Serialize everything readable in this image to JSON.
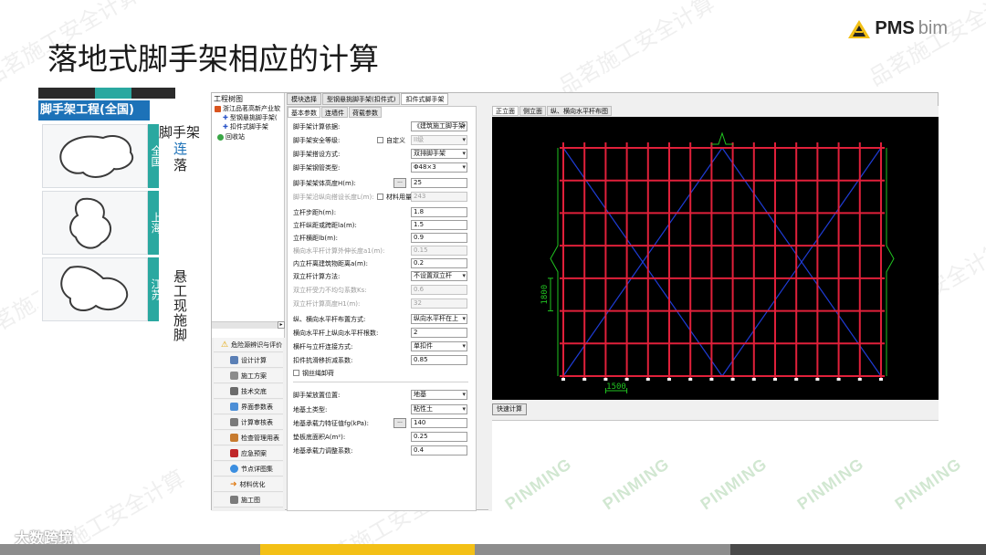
{
  "slide": {
    "title": "落地式脚手架相应的计算",
    "logo_main": "PMS",
    "logo_sub": "bim",
    "watermarks": [
      "品茗施工安全计算",
      "品茗施工安全计算",
      "品茗施工安全计算",
      "品茗施工安全计算",
      "品茗施工安全计算",
      "品茗施工安全计算",
      "品茗施工安全计算",
      "品茗施工安全计算"
    ],
    "green_watermark": "PINMING",
    "footer_brand": "大数跨境",
    "colors": {
      "accent_yellow": "#f3c016",
      "strip_gray": "#8d8d8d",
      "strip_dark": "#4a4a4a",
      "scaffold_red": "#e0203a",
      "brace_blue": "#1f3cd6",
      "dim_green": "#21c421"
    }
  },
  "bg_app": {
    "header": "脚手架工程(全国)",
    "regions": [
      "全国",
      "上海",
      "江苏"
    ],
    "tree_lines": [
      "脚手架",
      "连",
      "落",
      "悬",
      "工",
      "现",
      "施",
      "脚"
    ]
  },
  "tree": {
    "title": "工程树图",
    "items": [
      "浙江品茗高新产业软",
      "型钢悬挑脚手架(",
      "扣件式脚手架",
      "回收站"
    ]
  },
  "nav": {
    "items": [
      "危险源辨识与评价",
      "设计计算",
      "施工方案",
      "技术交底",
      "界面参数表",
      "计算审核表",
      "检查管理用表",
      "应急预案",
      "节点详图集",
      "材料优化",
      "施工图"
    ]
  },
  "top_tabs": [
    "模块选择",
    "型钢悬挑脚手架(扣件式)",
    "扣件式脚手架"
  ],
  "sub_tabs": [
    "基本参数",
    "连墙件",
    "荷载参数"
  ],
  "params": {
    "calc_basis": {
      "label": "脚手架计算依据:",
      "value": "《建筑施工脚手架"
    },
    "safety_grade": {
      "label": "脚手架安全等级:",
      "custom": "自定义",
      "value": "II级"
    },
    "erect_mode": {
      "label": "脚手架搭设方式:",
      "value": "双排脚手架"
    },
    "tube_type": {
      "label": "脚手架钢管类型:",
      "value": "Φ48×3"
    },
    "total_height": {
      "label": "脚手架架体高度H(m):",
      "value": "25"
    },
    "tube_length": {
      "label": "脚手架沿纵向搭设长度L(m):",
      "custom": "材料用量",
      "value": "243"
    },
    "step": {
      "label": "立杆步距h(m):",
      "value": "1.8"
    },
    "long_spacing": {
      "label": "立杆纵距或跨距la(m):",
      "value": "1.5"
    },
    "cross_spacing": {
      "label": "立杆横距lb(m):",
      "value": "0.9"
    },
    "cross_ext": {
      "label": "横向水平杆计算外伸长度a1(m):",
      "value": "0.15"
    },
    "inner_dist": {
      "label": "内立杆离建筑物距离a(m):",
      "value": "0.2"
    },
    "double_pole": {
      "label": "双立杆计算方法:",
      "value": "不设置双立杆"
    },
    "double_ratio": {
      "label": "双立杆受力不均匀系数Ks:",
      "value": "0.6"
    },
    "double_height": {
      "label": "双立杆计算高度H1(m):",
      "value": "32"
    },
    "horizontal_layout": {
      "label": "纵、横向水平杆布置方式:",
      "value": "纵向水平杆在上"
    },
    "horizontal_count": {
      "label": "横向水平杆上纵向水平杆根数:",
      "value": "2"
    },
    "connect_mode": {
      "label": "横杆与立杆连接方式:",
      "value": "单扣件"
    },
    "slip_coeff": {
      "label": "扣件抗滑移折减系数:",
      "value": "0.85"
    },
    "steel_cap": {
      "label": "钢丝绳卸荷"
    },
    "base_pos": {
      "label": "脚手架放置位置:",
      "value": "地基"
    },
    "soil_type": {
      "label": "地基土类型:",
      "value": "粘性土"
    },
    "bearing": {
      "label": "地基承载力特征值fg(kPa):",
      "value": "140"
    },
    "pad_area": {
      "label": "垫板底面积A(m²):",
      "value": "0.25"
    },
    "adjust_coeff": {
      "label": "地基承载力调整系数:",
      "value": "0.4"
    }
  },
  "view_tabs": [
    "正立面",
    "侧立面",
    "纵、横向水平杆布图"
  ],
  "drawing": {
    "dim_vertical": "1800",
    "dim_horizontal": "1500",
    "columns": 15,
    "rows": 7
  },
  "fast_calc": "快速计算"
}
